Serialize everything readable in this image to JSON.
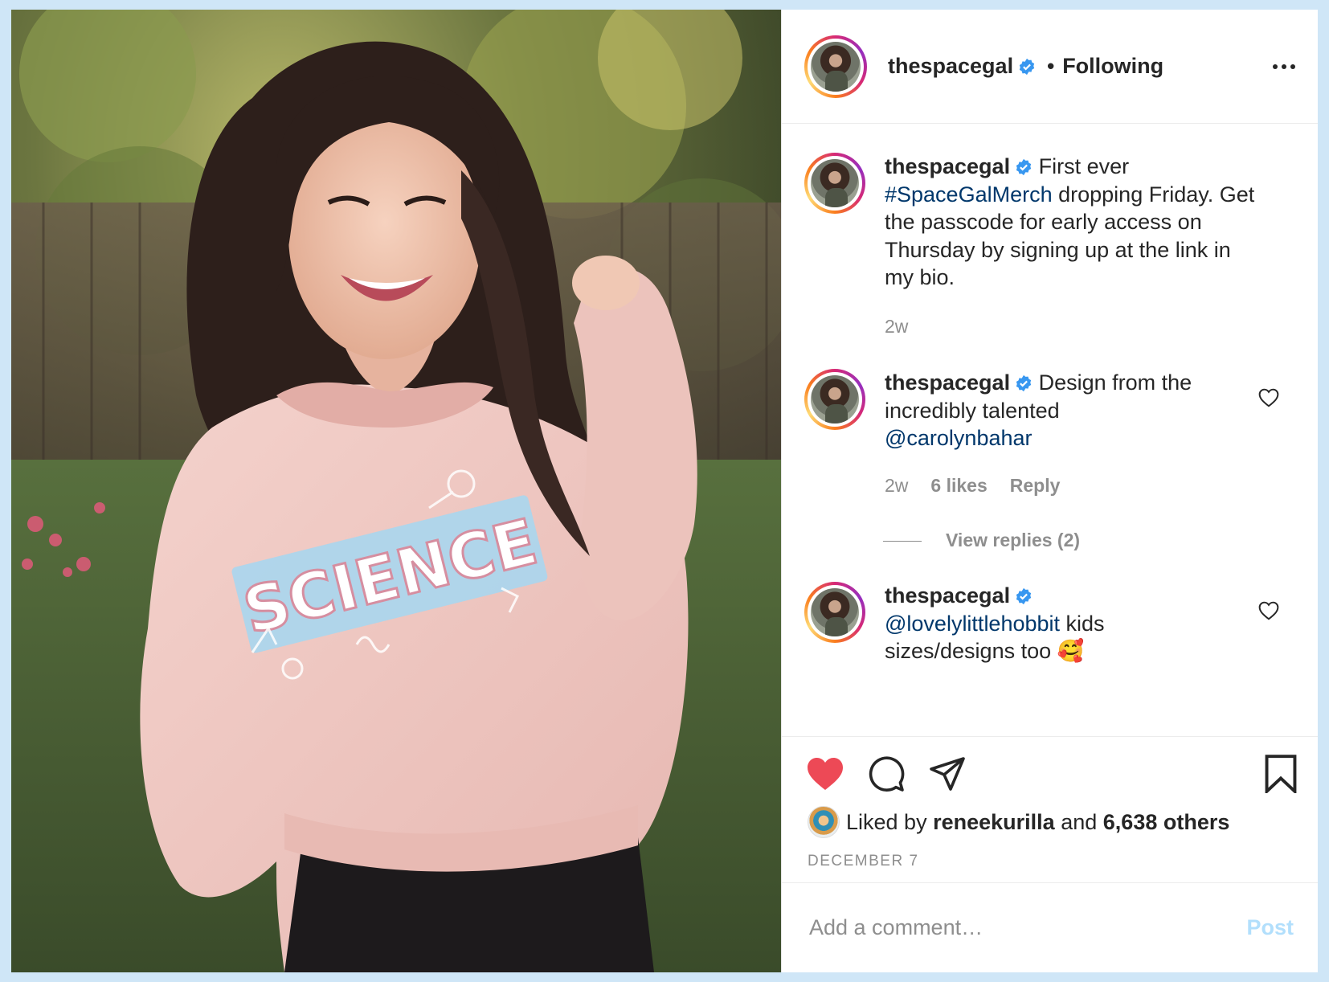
{
  "post": {
    "username": "thespacegal",
    "follow_status": "Following",
    "separator": "•"
  },
  "photo": {
    "shirt_text": "SCIENCE"
  },
  "comments": [
    {
      "username": "thespacegal",
      "text_before": "First ever",
      "hashtag": "#SpaceGalMerch",
      "text_after": "dropping Friday. Get the passcode for early access on Thursday by signing up at the link in my bio.",
      "time": "2w"
    },
    {
      "username": "thespacegal",
      "text_before": "Design from the incredibly talented",
      "mention": "@carolynbahar",
      "time": "2w",
      "likes": "6 likes",
      "reply": "Reply",
      "view_replies": "View replies (2)"
    },
    {
      "username": "thespacegal",
      "mention": "@lovelylittlehobbit",
      "text_after": "kids sizes/designs too 🥰"
    }
  ],
  "actions": {
    "liked_prefix": "Liked by",
    "liked_user": "reneekurilla",
    "liked_and": "and",
    "liked_others": "6,638 others",
    "date": "DECEMBER 7"
  },
  "composer": {
    "placeholder": "Add a comment…",
    "post_label": "Post"
  },
  "colors": {
    "background": "#cfe6f7",
    "link": "#00376b",
    "verified": "#3897f0",
    "like_red": "#ed4956",
    "post_disabled": "#b2dffc"
  },
  "icons": [
    "verified-badge-icon",
    "more-options-icon",
    "heart-icon",
    "comment-icon",
    "share-icon",
    "bookmark-icon"
  ]
}
